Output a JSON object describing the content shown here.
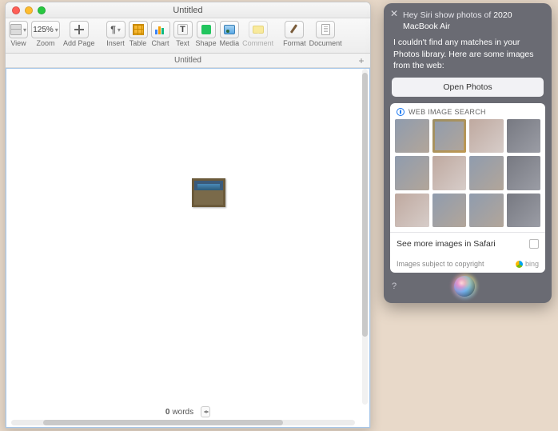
{
  "pages": {
    "window_title": "Untitled",
    "toolbar": {
      "view": "View",
      "zoom": "Zoom",
      "zoom_value": "125%",
      "add_page": "Add Page",
      "insert": "Insert",
      "table": "Table",
      "chart": "Chart",
      "text": "Text",
      "shape": "Shape",
      "media": "Media",
      "comment": "Comment",
      "format": "Format",
      "document": "Document"
    },
    "tab_title": "Untitled",
    "word_count_value": "0",
    "word_count_label": "words"
  },
  "siri": {
    "query_prefix": "Hey Siri show photos of ",
    "query_highlight": "2020 MacBook Air",
    "message": "I couldn't find any matches in your Photos library. Here are some images from the web:",
    "open_photos": "Open Photos",
    "web_search_header": "WEB IMAGE SEARCH",
    "see_more": "See more images in Safari",
    "copyright": "Images subject to copyright",
    "provider": "bing"
  }
}
